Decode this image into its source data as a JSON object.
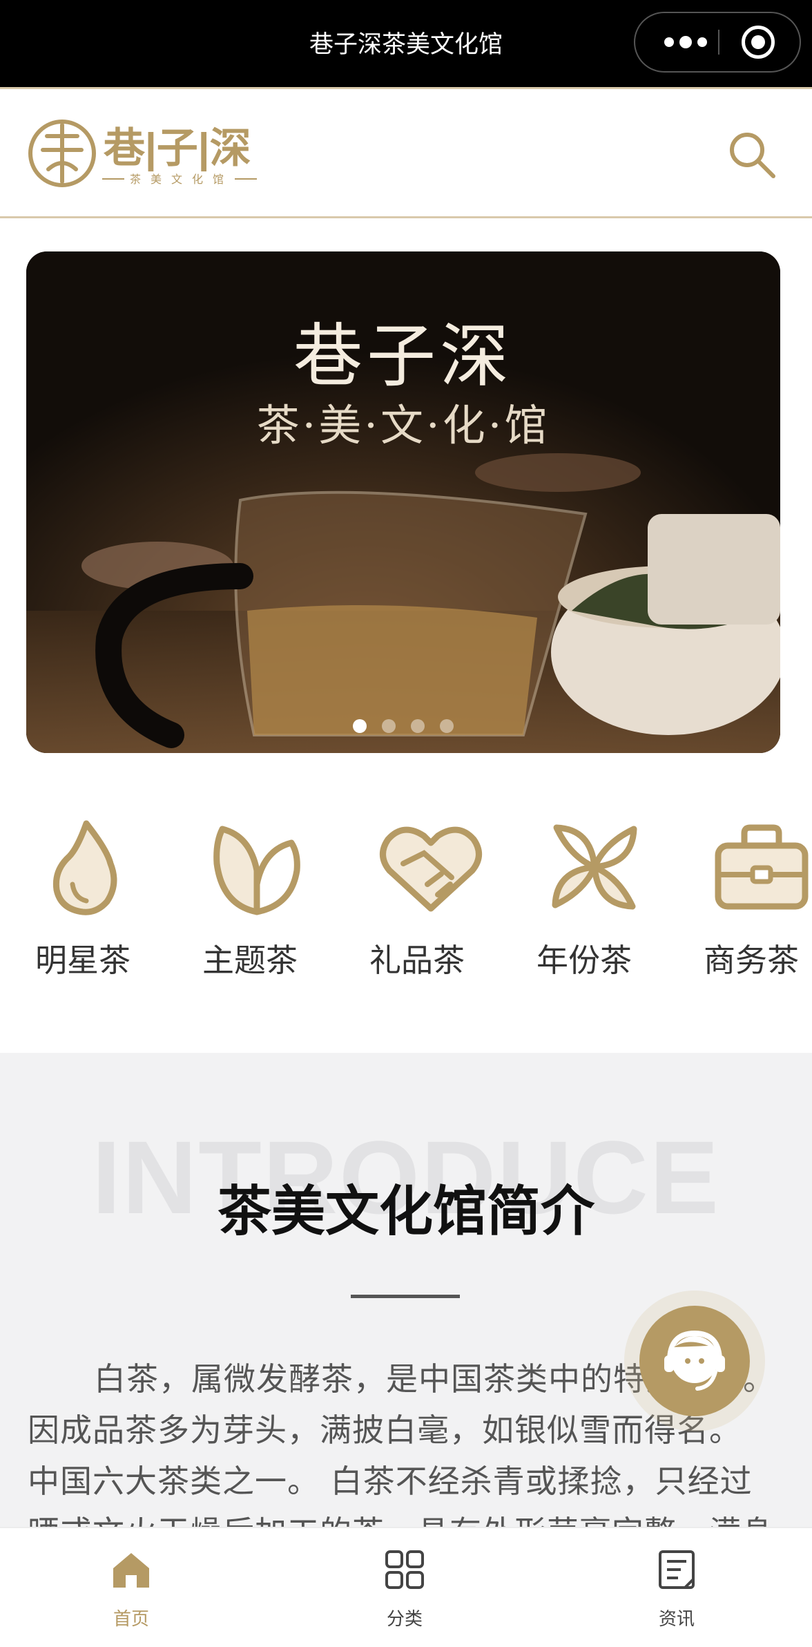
{
  "topbar": {
    "title": "巷子深茶美文化馆",
    "more_icon": "more-dots-icon",
    "close_icon": "target-circle-icon"
  },
  "header": {
    "logo_text": "巷|子|深",
    "logo_sub": "茶美文化馆",
    "search_icon": "search-icon"
  },
  "banner": {
    "title": "巷子深",
    "subtitle": "茶·美·文·化·馆",
    "slide_count": 4,
    "active_index": 0
  },
  "categories": [
    {
      "label": "明星茶",
      "icon": "flame-icon"
    },
    {
      "label": "主题茶",
      "icon": "leaf-icon"
    },
    {
      "label": "礼品茶",
      "icon": "heart-handshake-icon"
    },
    {
      "label": "年份茶",
      "icon": "pinwheel-icon"
    },
    {
      "label": "商务茶",
      "icon": "briefcase-icon"
    }
  ],
  "intro": {
    "bg_word": "INTRODUCE",
    "heading": "茶美文化馆简介",
    "paragraph": "白茶，属微发酵茶，是中国茶类中的特殊珍品。 因成品茶多为芽头，满披白毫，如银似雪而得名。 中国六大茶类之一。 白茶不经杀青或揉捻，只经过晒或文火干燥后加工的茶，具有外形芽毫完整，满身披毫，毫香清鲜，汤色黄绿清澈。"
  },
  "service": {
    "icon": "customer-service-icon"
  },
  "tabbar": {
    "items": [
      {
        "label": "首页",
        "icon": "home-icon",
        "active": true
      },
      {
        "label": "分类",
        "icon": "grid-icon",
        "active": false
      },
      {
        "label": "资讯",
        "icon": "news-icon",
        "active": false
      }
    ]
  },
  "colors": {
    "accent": "#b59a64",
    "accent_light": "#f3e9d8",
    "topbar_bg": "#000000",
    "intro_bg": "#f2f2f3"
  }
}
